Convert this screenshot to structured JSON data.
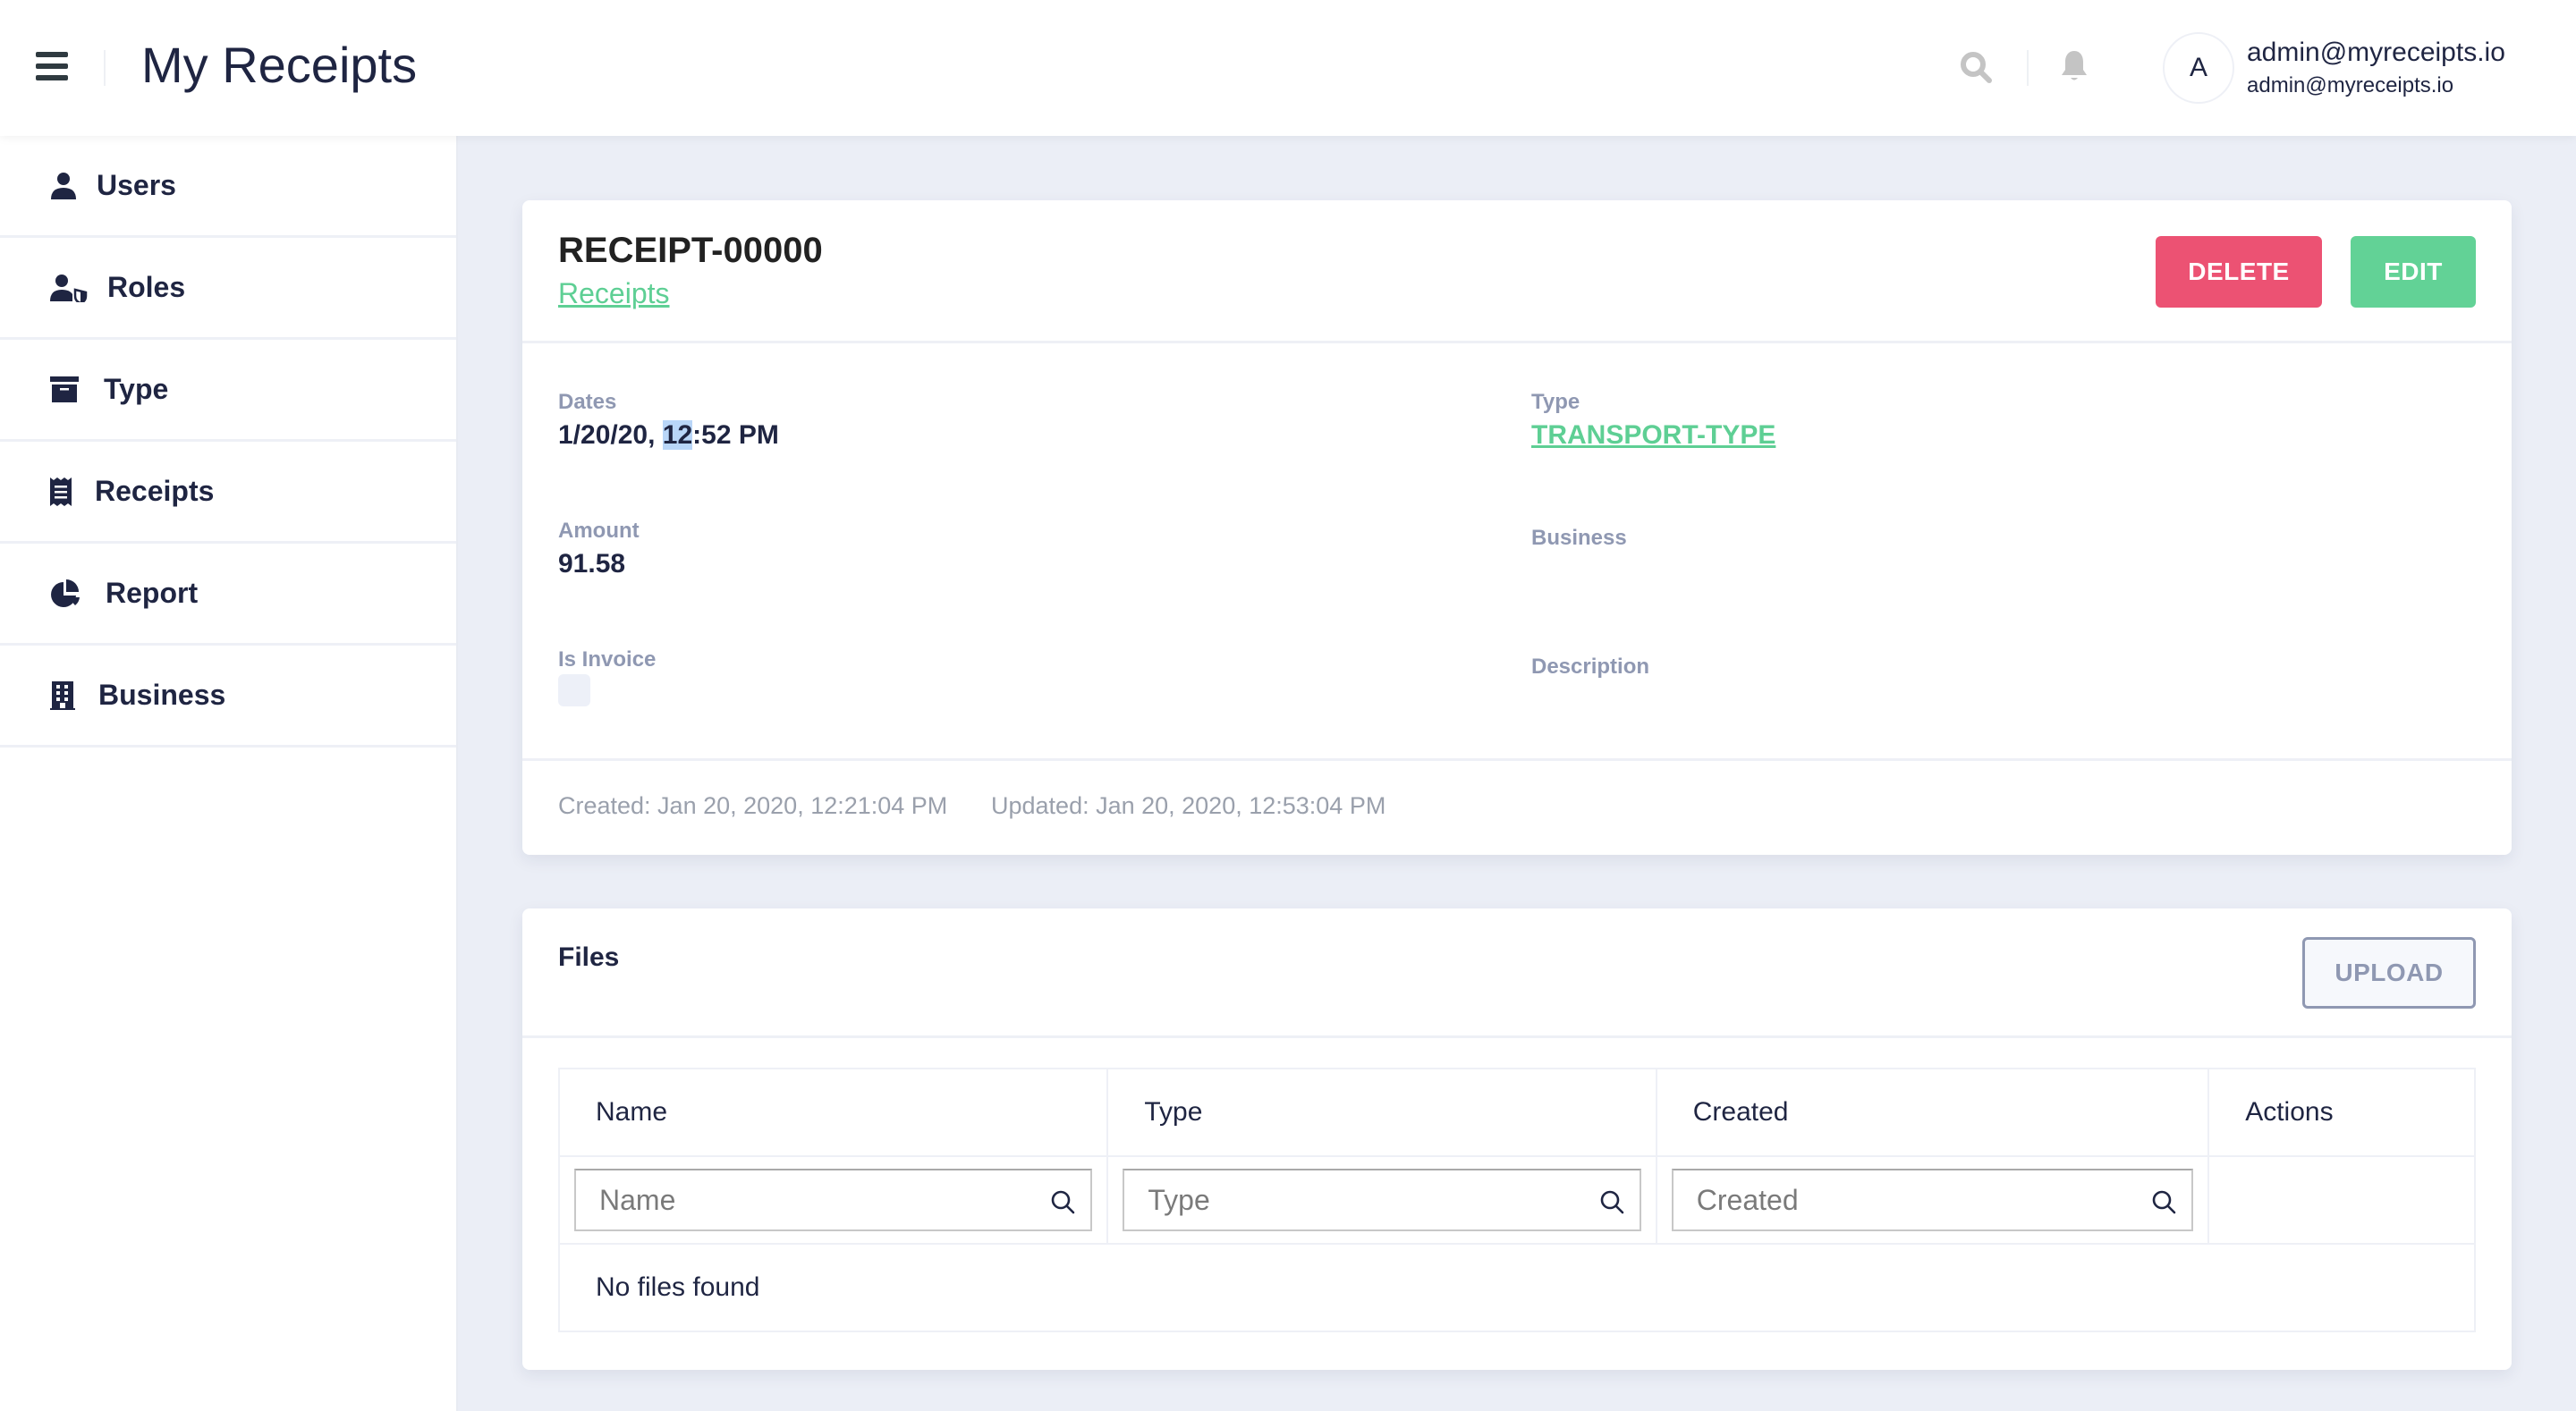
{
  "header": {
    "app_title": "My Receipts",
    "user_name": "admin@myreceipts.io",
    "user_email": "admin@myreceipts.io",
    "avatar_initial": "A"
  },
  "sidebar": {
    "items": [
      {
        "label": "Users",
        "icon": "user-icon"
      },
      {
        "label": "Roles",
        "icon": "user-shield-icon"
      },
      {
        "label": "Type",
        "icon": "archive-icon"
      },
      {
        "label": "Receipts",
        "icon": "receipt-icon"
      },
      {
        "label": "Report",
        "icon": "pie-chart-icon"
      },
      {
        "label": "Business",
        "icon": "building-icon"
      }
    ]
  },
  "receipt": {
    "title": "RECEIPT-00000",
    "breadcrumb": "Receipts",
    "delete_label": "DELETE",
    "edit_label": "EDIT",
    "fields": {
      "dates_label": "Dates",
      "dates_value_pre": "1/20/20, ",
      "dates_value_sel": "12",
      "dates_value_post": ":52 PM",
      "type_label": "Type",
      "type_value": "TRANSPORT-TYPE",
      "amount_label": "Amount",
      "amount_value": "91.58",
      "business_label": "Business",
      "is_invoice_label": "Is Invoice",
      "is_invoice_value": false,
      "description_label": "Description"
    },
    "created": "Created: Jan 20, 2020, 12:21:04 PM",
    "updated": "Updated: Jan 20, 2020, 12:53:04 PM"
  },
  "files": {
    "title": "Files",
    "upload_label": "UPLOAD",
    "columns": [
      "Name",
      "Type",
      "Created",
      "Actions"
    ],
    "filters": {
      "name_placeholder": "Name",
      "type_placeholder": "Type",
      "created_placeholder": "Created"
    },
    "empty_message": "No files found"
  },
  "colors": {
    "accent_green": "#62d296",
    "link_green": "#5ecf94",
    "danger": "#ec5273",
    "muted": "#8f98b2",
    "text": "#1f2542"
  }
}
